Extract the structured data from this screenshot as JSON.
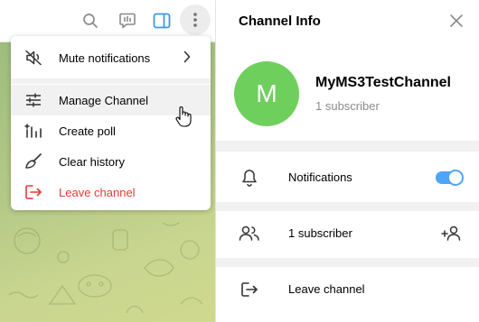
{
  "header": {
    "icons": [
      "search-icon",
      "comments-icon",
      "sidebar-toggle-icon",
      "more-icon"
    ]
  },
  "menu": {
    "items": [
      {
        "label": "Mute notifications",
        "icon": "mute-icon",
        "has_submenu": true
      },
      {
        "label": "Manage Channel",
        "icon": "sliders-icon",
        "hovered": true
      },
      {
        "label": "Create poll",
        "icon": "poll-icon"
      },
      {
        "label": "Clear history",
        "icon": "broom-icon"
      },
      {
        "label": "Leave channel",
        "icon": "leave-icon",
        "danger": true
      }
    ]
  },
  "panel": {
    "title": "Channel Info",
    "avatar_letter": "M",
    "channel_name": "MyMS3TestChannel",
    "subscribers_line": "1 subscriber",
    "rows": {
      "notifications": {
        "label": "Notifications",
        "enabled": true
      },
      "subscribers": {
        "label": "1 subscriber"
      },
      "leave": {
        "label": "Leave channel"
      }
    }
  },
  "colors": {
    "accent": "#4ea4f6",
    "avatar": "#6fcf5d",
    "danger": "#e53935",
    "secondary_text": "#8a8a8a"
  }
}
